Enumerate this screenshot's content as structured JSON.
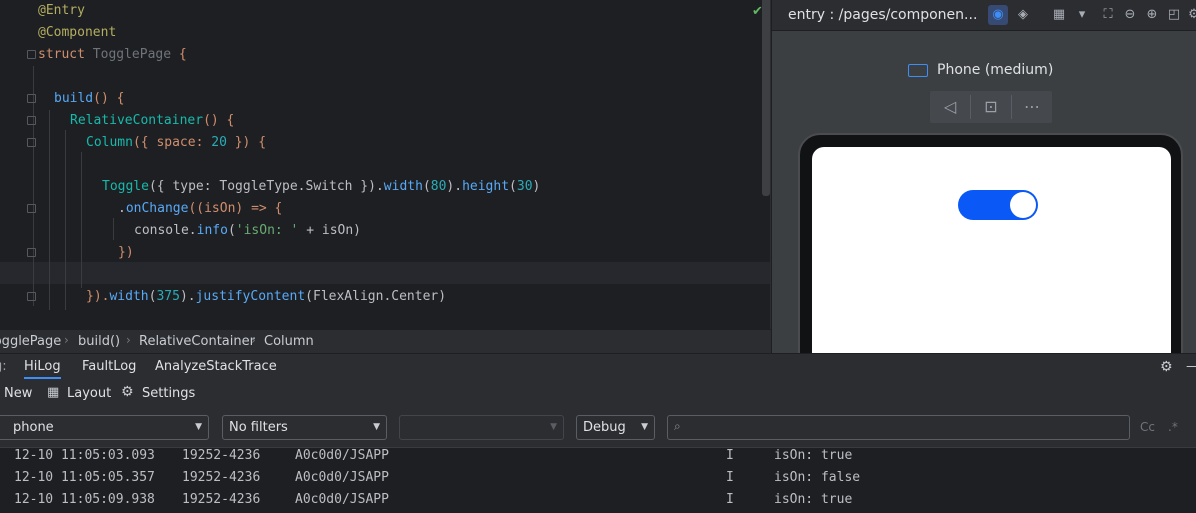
{
  "editor": {
    "lines": {
      "l1": "@Entry",
      "l2": "@Component",
      "l3_kw": "struct ",
      "l3_name": "TogglePage",
      "l3_end": " {",
      "l5_fn": "build",
      "l5_end": "() {",
      "l6_fn": "RelativeContainer",
      "l6_end": "() {",
      "l7_fn": "Column",
      "l7_a": "({ space: ",
      "l7_num": "20",
      "l7_end": " }) {",
      "l9_fn": "Toggle",
      "l9_a": "({ type: ToggleType.",
      "l9_b": "Switch",
      "l9_c": " }).",
      "l9_d": "width",
      "l9_e": "(",
      "l9_num1": "80",
      "l9_f": ").",
      "l9_g": "height",
      "l9_h": "(",
      "l9_num2": "30",
      "l9_i": ")",
      "l10_a": ".",
      "l10_fn": "onChange",
      "l10_b": "((isOn) => {",
      "l11_a": "console.",
      "l11_fn": "info",
      "l11_b": "(",
      "l11_str": "'isOn: '",
      "l11_c": " + isOn)",
      "l12": "})",
      "l14_a": "}).",
      "l14_fn": "width",
      "l14_b": "(",
      "l14_num": "375",
      "l14_c": ").",
      "l14_fn2": "justifyContent",
      "l14_d": "(FlexAlign.",
      "l14_e": "Center",
      "l14_f": ")"
    }
  },
  "breadcrumb": [
    "TogglePage",
    "build()",
    "RelativeContainer",
    "Column"
  ],
  "preview": {
    "title": "entry : /pages/componen...",
    "device_name": "Phone (medium)",
    "toggle_on": true,
    "accent": "#0a59f7"
  },
  "log_panel": {
    "tab_prefix": "g:",
    "tabs": [
      "HiLog",
      "FaultLog",
      "AnalyzeStackTrace"
    ],
    "toolbar": {
      "new_label": "New",
      "layout_label": "Layout",
      "settings_label": "Settings"
    },
    "filters": {
      "device": "phone",
      "filter": "No filters",
      "process": "",
      "level": "Debug",
      "search_placeholder": "",
      "cc_label": "Cc",
      "regex_label": ".*"
    },
    "rows": [
      {
        "time": "12-10 11:05:03.093",
        "pid": "19252-4236",
        "tag": "A0c0d0/JSAPP",
        "level": "I",
        "msg": "isOn: true"
      },
      {
        "time": "12-10 11:05:05.357",
        "pid": "19252-4236",
        "tag": "A0c0d0/JSAPP",
        "level": "I",
        "msg": "isOn: false"
      },
      {
        "time": "12-10 11:05:09.938",
        "pid": "19252-4236",
        "tag": "A0c0d0/JSAPP",
        "level": "I",
        "msg": "isOn: true"
      }
    ]
  }
}
